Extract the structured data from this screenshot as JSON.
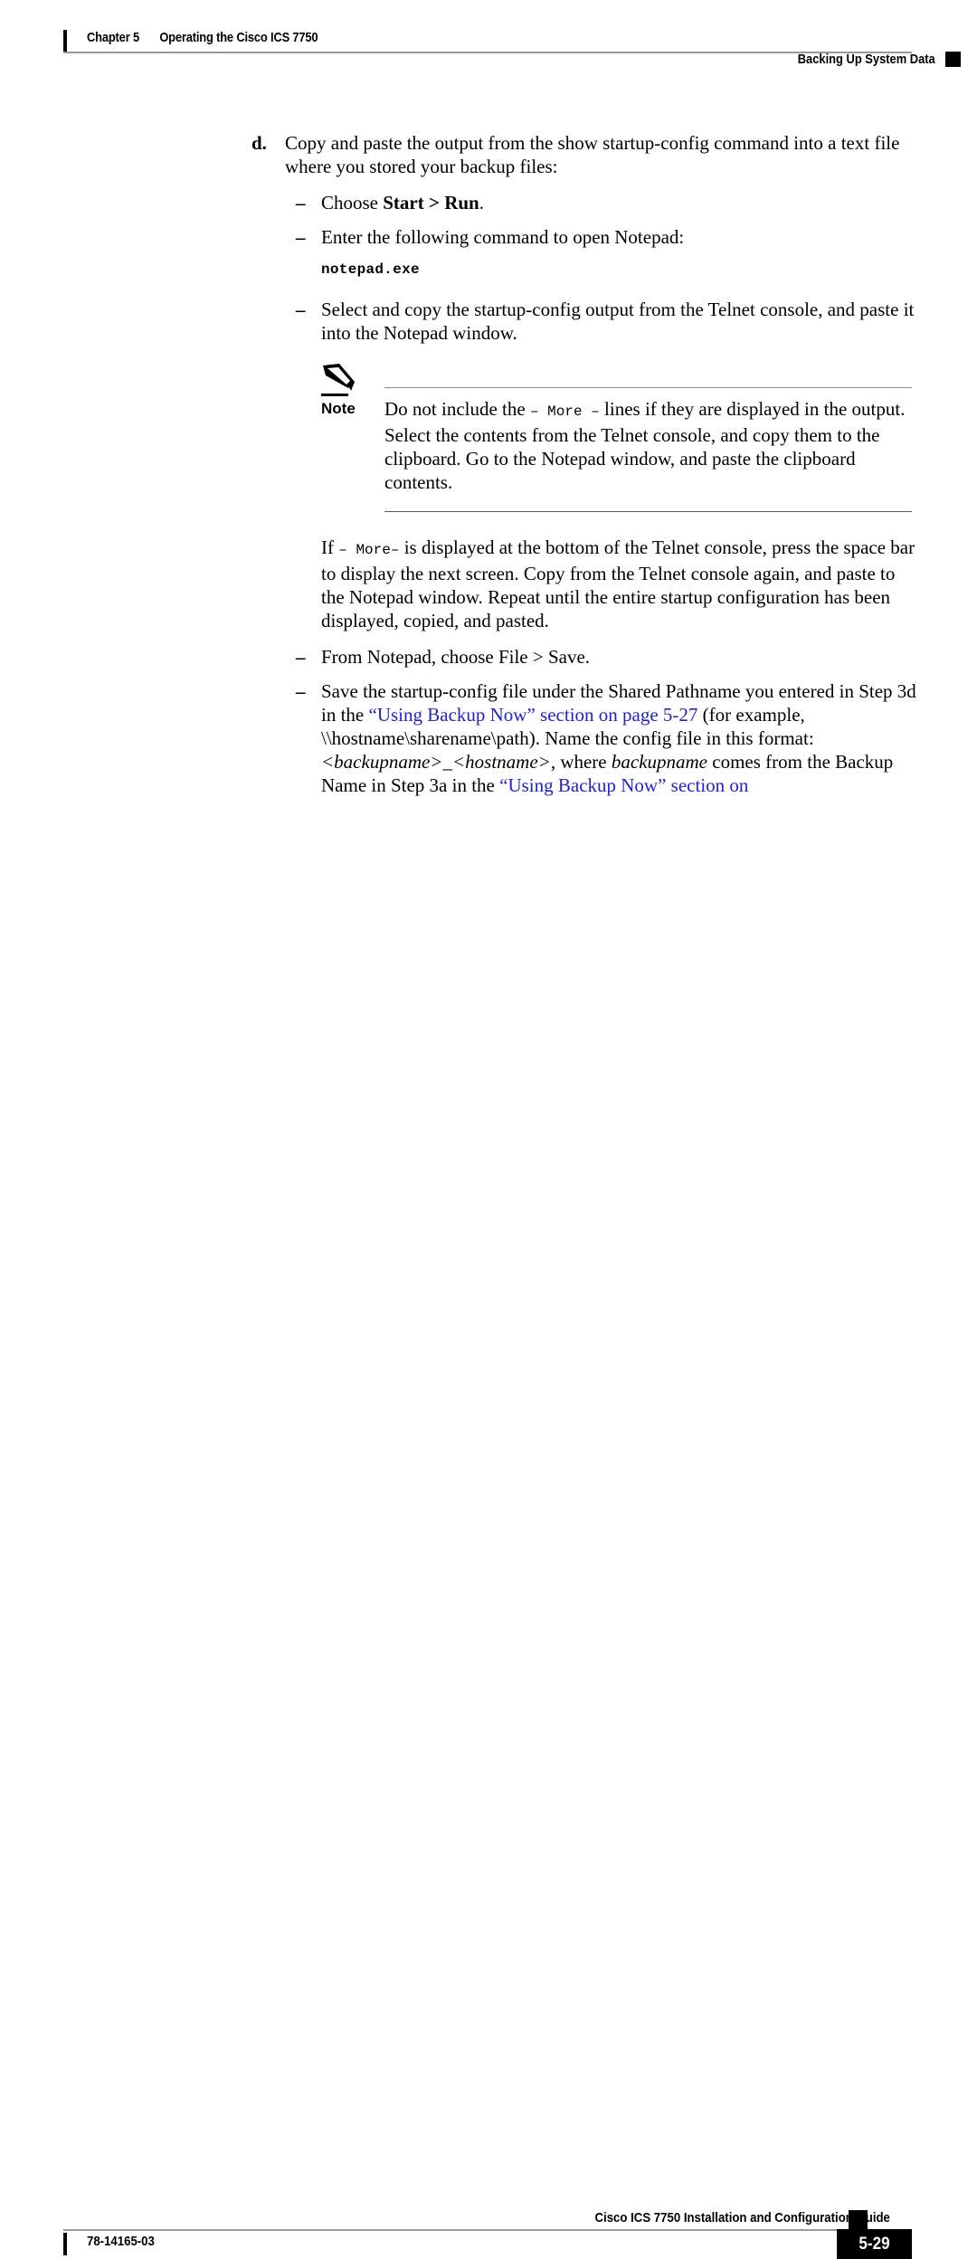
{
  "header": {
    "chapter_number": "Chapter 5",
    "chapter_title": "Operating the Cisco ICS 7750",
    "running_head": "Backing Up System Data"
  },
  "content": {
    "step": {
      "marker": "d.",
      "text": "Copy and paste the output from the show startup-config command into a text file where you stored your backup files:"
    },
    "bullets": [
      {
        "mark": "–",
        "prefix": "Choose ",
        "bold": "Start > Run",
        "suffix": "."
      },
      {
        "mark": "–",
        "text": "Enter the following command to open Notepad:"
      },
      {
        "mark": "–",
        "text": "Select and copy the startup-config output from the Telnet console, and paste it into the Notepad window."
      },
      {
        "mark": "–",
        "text": "From Notepad, choose File > Save."
      }
    ],
    "command": "notepad.exe",
    "note": {
      "label": "Note",
      "icon": "pencil-icon",
      "text_part1": "Do not include the ",
      "text_mono": "– More –",
      "text_part2": " lines if they are displayed in the output. Select the contents from the Telnet console, and copy them to the clipboard. Go to the Notepad window, and paste the clipboard contents."
    },
    "paragraph": {
      "part1": "If ",
      "mono": "– More–",
      "part2": " is displayed at the bottom of the Telnet console, press the space bar to display the next screen. Copy from the Telnet console again, and paste to the Notepad window. Repeat until the entire startup configuration has been displayed, copied, and pasted."
    },
    "final_bullet": {
      "mark": "–",
      "seg1": "Save the startup-config file under the Shared Pathname you entered in Step 3d in the ",
      "link1": "“Using Backup Now” section on page 5-27",
      "seg2": " (for example, \\\\hostname\\sharename\\path). Name the config file in this format: ",
      "italic1": "<backupname>_<hostname>",
      "seg3": ", where ",
      "italic2": "backupname",
      "seg4": " comes from the Backup Name in Step 3a in the ",
      "link2": "“Using Backup Now” section on"
    }
  },
  "footer": {
    "guide_title": "Cisco ICS 7750 Installation and Configuration Guide",
    "document_number": "78-14165-03",
    "page_number": "5-29"
  },
  "colors": {
    "link": "#2222cc",
    "rule": "#9a9a9a",
    "text": "#000000"
  }
}
